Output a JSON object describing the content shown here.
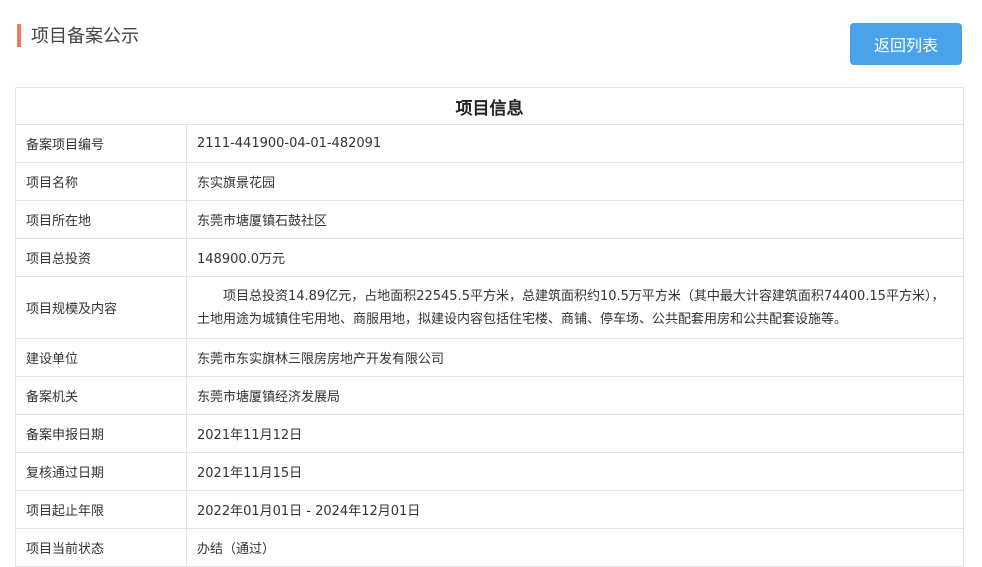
{
  "header": {
    "title": "项目备案公示",
    "back_button_label": "返回列表"
  },
  "table": {
    "heading": "项目信息",
    "rows": [
      {
        "label": "备案项目编号",
        "value": "2111-441900-04-01-482091"
      },
      {
        "label": "项目名称",
        "value": "东实旗景花园"
      },
      {
        "label": "项目所在地",
        "value": "东莞市塘厦镇石鼓社区"
      },
      {
        "label": "项目总投资",
        "value": "148900.0万元"
      },
      {
        "label": "项目规模及内容",
        "value": "项目总投资14.89亿元，占地面积22545.5平方米，总建筑面积约10.5万平方米（其中最大计容建筑面积74400.15平方米），土地用途为城镇住宅用地、商服用地，拟建设内容包括住宅楼、商铺、停车场、公共配套用房和公共配套设施等。"
      },
      {
        "label": "建设单位",
        "value": "东莞市东实旗林三限房房地产开发有限公司"
      },
      {
        "label": "备案机关",
        "value": "东莞市塘厦镇经济发展局"
      },
      {
        "label": "备案申报日期",
        "value": "2021年11月12日"
      },
      {
        "label": "复核通过日期",
        "value": "2021年11月15日"
      },
      {
        "label": "项目起止年限",
        "value": "2022年01月01日 - 2024年12月01日"
      },
      {
        "label": "项目当前状态",
        "value": "办结（通过）"
      }
    ]
  }
}
